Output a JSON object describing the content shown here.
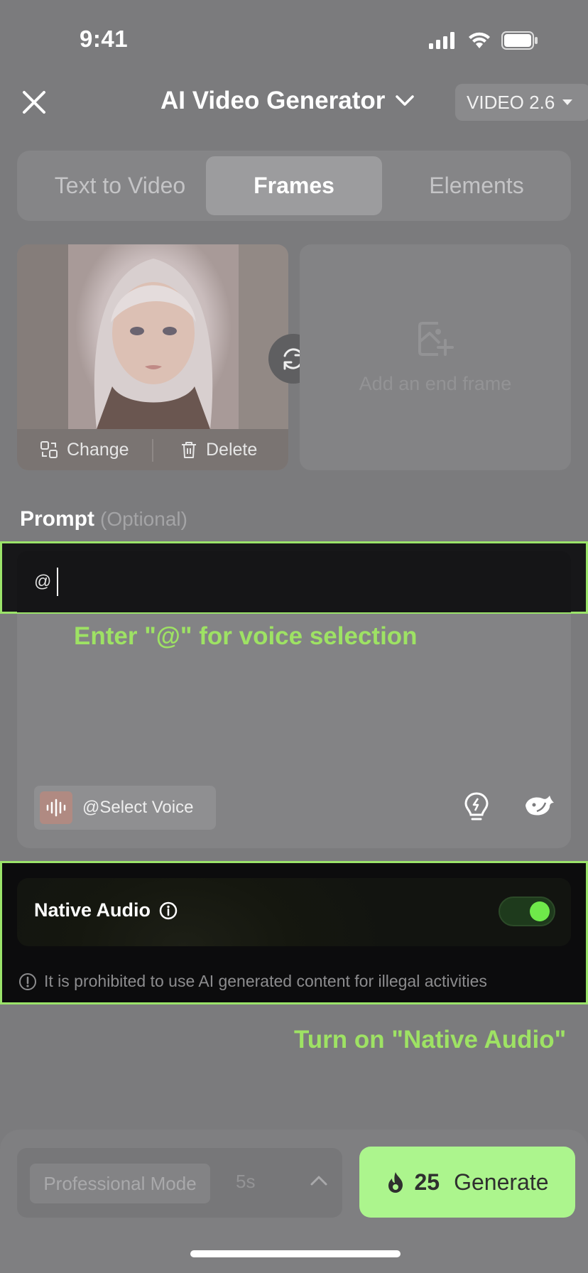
{
  "status_bar": {
    "time": "9:41"
  },
  "header": {
    "title": "AI Video Generator",
    "version": "VIDEO 2.6"
  },
  "tabs": [
    {
      "label": "Text to Video",
      "active": false
    },
    {
      "label": "Frames",
      "active": true
    },
    {
      "label": "Elements",
      "active": false
    }
  ],
  "frames": {
    "change_label": "Change",
    "delete_label": "Delete",
    "end_frame_label": "Add an end frame"
  },
  "prompt": {
    "label": "Prompt",
    "optional": "(Optional)",
    "value": "@",
    "select_voice": "@Select Voice"
  },
  "annotations": {
    "hint_voice": "Enter \"@\" for voice selection",
    "hint_audio": "Turn on \"Native Audio\"",
    "highlight_color": "#9be36a"
  },
  "native_audio": {
    "label": "Native Audio",
    "enabled": true,
    "warning": "It is prohibited to use AI generated content for illegal activities"
  },
  "bottom_bar": {
    "mode": "Professional Mode",
    "duration": "5s",
    "credits": "25",
    "generate_label": "Generate",
    "generate_color": "#acf58d"
  }
}
